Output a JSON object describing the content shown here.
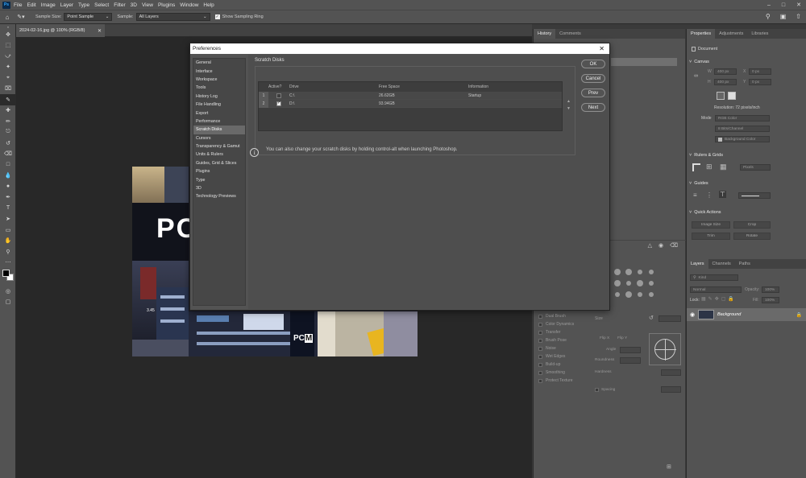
{
  "menubar": {
    "logo": "Ps",
    "items": [
      "File",
      "Edit",
      "Image",
      "Layer",
      "Type",
      "Select",
      "Filter",
      "3D",
      "View",
      "Plugins",
      "Window",
      "Help"
    ]
  },
  "options": {
    "sample_size_label": "Sample Size:",
    "sample_size_value": "Point Sample",
    "sample_label": "Sample:",
    "sample_value": "All Layers",
    "show_ring_label": "Show Sampling Ring"
  },
  "document": {
    "tab_title": "2024-02-16.jpg @ 100% (RGB/8)",
    "photo_text_1": "PC",
    "photo_text_2": "PC",
    "photo_text_3": "M",
    "photo_text_4": "3.45"
  },
  "mid_panel": {
    "tabs": [
      "History",
      "Comments"
    ],
    "brush_items": [
      "Dual Brush",
      "Color Dynamics",
      "Transfer",
      "Brush Pose",
      "Noise",
      "Wet Edges",
      "Build-up",
      "Smoothing",
      "Protect Texture"
    ],
    "size_label": "Size",
    "flip_x": "Flip X",
    "flip_y": "Flip Y",
    "angle_label": "Angle",
    "roundness_label": "Roundness",
    "hardness_label": "Hardness",
    "spacing_label": "Spacing"
  },
  "right_panel": {
    "tabs": [
      "Properties",
      "Adjustments",
      "Libraries"
    ],
    "document_label": "Document",
    "canvas_label": "Canvas",
    "w_label": "W",
    "h_label": "H",
    "x_label": "X",
    "y_label": "Y",
    "w_value": "400 px",
    "h_value": "400 px",
    "x_value": "0 px",
    "y_value": "0 px",
    "resolution": "Resolution: 72 pixels/inch",
    "mode_label": "Mode",
    "mode_value": "RGB Color",
    "depth_value": "8 Bits/Channel",
    "fill_value": "Background Color",
    "rulers_label": "Rulers & Grids",
    "rulers_units": "Pixels",
    "guides_label": "Guides",
    "quick_actions_label": "Quick Actions",
    "qa_buttons": [
      "Image Size",
      "Crop",
      "Trim",
      "Rotate"
    ],
    "layers_tabs": [
      "Layers",
      "Channels",
      "Paths"
    ],
    "kind_label": "Kind",
    "blend_mode": "Normal",
    "opacity_label": "Opacity:",
    "opacity_value": "100%",
    "lock_label": "Lock:",
    "fill_label": "Fill:",
    "fill_pct": "100%",
    "layer_name": "Background"
  },
  "dialog": {
    "title": "Preferences",
    "categories": [
      "General",
      "Interface",
      "Workspace",
      "Tools",
      "History Log",
      "File Handling",
      "Export",
      "Performance",
      "Scratch Disks",
      "Cursors",
      "Transparency & Gamut",
      "Units & Rulers",
      "Guides, Grid & Slices",
      "Plugins",
      "Type",
      "3D",
      "Technology Previews"
    ],
    "selected_category": "Scratch Disks",
    "section_title": "Scratch Disks",
    "columns": [
      "Active?",
      "Drive",
      "Free Space",
      "Information"
    ],
    "rows": [
      {
        "num": "1",
        "active": false,
        "drive": "C:\\",
        "free": "26.62GB",
        "info": "Startup"
      },
      {
        "num": "2",
        "active": true,
        "drive": "D:\\",
        "free": "93.94GB",
        "info": ""
      }
    ],
    "buttons": {
      "ok": "OK",
      "cancel": "Cancel",
      "prev": "Prev",
      "next": "Next"
    },
    "info_text": "You can also change your scratch disks by holding control-alt when launching Photoshop."
  }
}
